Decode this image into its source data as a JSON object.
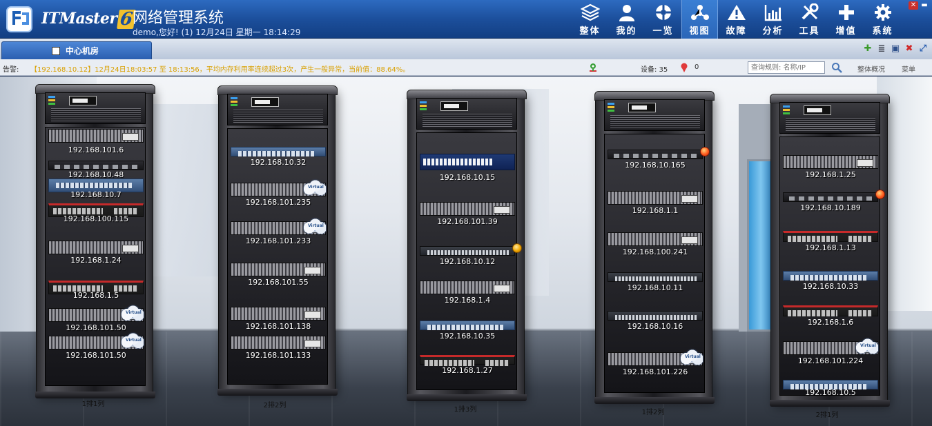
{
  "app": {
    "brand": "ITMaster",
    "version": "6",
    "title": "网络管理系统",
    "user_line": "demo,您好! (1) 12月24日 星期一 18:14:29"
  },
  "nav": [
    {
      "label": "整体",
      "icon": "layers-icon"
    },
    {
      "label": "我的",
      "icon": "user-icon"
    },
    {
      "label": "一览",
      "icon": "overview-icon"
    },
    {
      "label": "视图",
      "icon": "topology-icon",
      "active": true
    },
    {
      "label": "故障",
      "icon": "warning-icon"
    },
    {
      "label": "分析",
      "icon": "chart-icon"
    },
    {
      "label": "工具",
      "icon": "tools-icon"
    },
    {
      "label": "增值",
      "icon": "plus-icon"
    },
    {
      "label": "系统",
      "icon": "gear-icon"
    }
  ],
  "tab": {
    "label": "中心机房"
  },
  "alert_bar": {
    "label": "告警:",
    "message": "【192.168.10.12】12月24日18:03:57 至 18:13:56，平均内存利用率连续超过3次，产生一般异常，当前值：88.64%。",
    "device_label": "设备: 35",
    "alarm_count": "0",
    "search_placeholder": "查询规则: 名称/IP",
    "overview": "整体概况",
    "menu": "菜单"
  },
  "racks": [
    {
      "label": "1排1列",
      "devices": [
        {
          "ip": "192.168.101.6",
          "style": "gray"
        },
        {
          "ip": "192.168.10.48",
          "style": "dark"
        },
        {
          "ip": "192.168.10.7",
          "style": "blue"
        },
        {
          "ip": "192.168.100.115",
          "style": "red"
        },
        {
          "ip": "192.168.1.24",
          "style": "gray"
        },
        {
          "ip": "192.168.1.5",
          "style": "red"
        },
        {
          "ip": "192.168.101.50",
          "style": "gray",
          "cloud": true
        },
        {
          "ip": "192.168.101.50",
          "style": "gray",
          "cloud": true
        }
      ]
    },
    {
      "label": "2排2列",
      "devices": [
        {
          "ip": "192.168.10.32",
          "style": "blue"
        },
        {
          "ip": "192.168.101.235",
          "style": "gray",
          "cloud": true
        },
        {
          "ip": "192.168.101.233",
          "style": "gray",
          "cloud": true
        },
        {
          "ip": "192.168.101.55",
          "style": "gray"
        },
        {
          "ip": "192.168.101.138",
          "style": "gray"
        },
        {
          "ip": "192.168.101.133",
          "style": "gray"
        }
      ]
    },
    {
      "label": "1排3列",
      "devices": [
        {
          "ip": "192.168.10.15",
          "style": "navy"
        },
        {
          "ip": "192.168.101.39",
          "style": "gray"
        },
        {
          "ip": "192.168.10.12",
          "style": "strip",
          "alert": "warn"
        },
        {
          "ip": "192.168.1.4",
          "style": "gray"
        },
        {
          "ip": "192.168.10.35",
          "style": "blue"
        },
        {
          "ip": "192.168.1.27",
          "style": "red"
        }
      ]
    },
    {
      "label": "1排2列",
      "devices": [
        {
          "ip": "192.168.10.165",
          "style": "dark",
          "alert": "error"
        },
        {
          "ip": "192.168.1.1",
          "style": "gray"
        },
        {
          "ip": "192.168.100.241",
          "style": "gray"
        },
        {
          "ip": "192.168.10.11",
          "style": "strip"
        },
        {
          "ip": "192.168.10.16",
          "style": "strip"
        },
        {
          "ip": "192.168.101.226",
          "style": "gray",
          "cloud": true
        }
      ]
    },
    {
      "label": "2排1列",
      "devices": [
        {
          "ip": "192.168.1.25",
          "style": "gray"
        },
        {
          "ip": "192.168.10.189",
          "style": "dark",
          "alert": "error"
        },
        {
          "ip": "192.168.1.13",
          "style": "red"
        },
        {
          "ip": "192.168.10.33",
          "style": "blue"
        },
        {
          "ip": "192.168.1.6",
          "style": "red"
        },
        {
          "ip": "192.168.101.224",
          "style": "gray",
          "cloud": true
        },
        {
          "ip": "192.168.10.5",
          "style": "blue"
        }
      ]
    }
  ],
  "colors": {
    "header_bg": "#1c4f9c",
    "alert_text": "#d9a000",
    "rack_label": "#111111"
  }
}
